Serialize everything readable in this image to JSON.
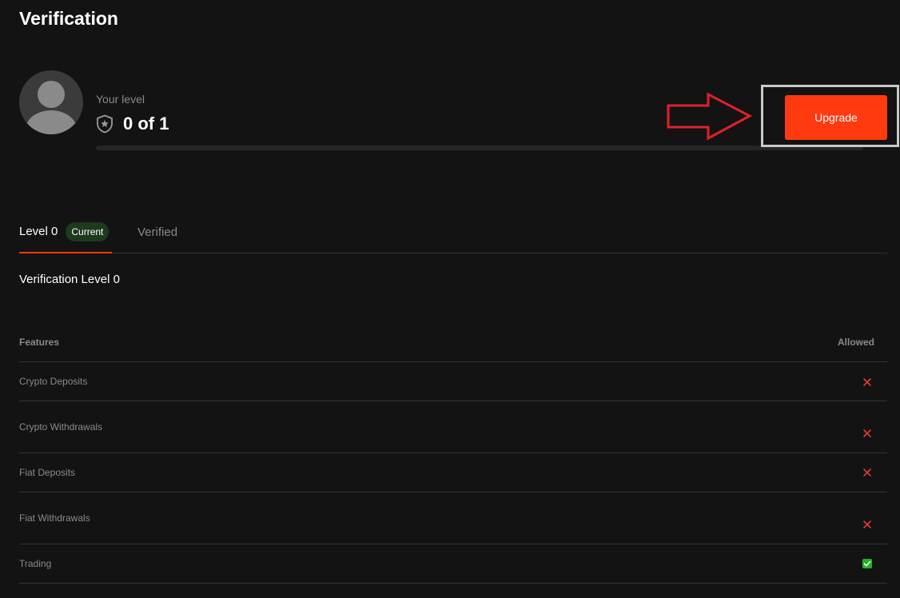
{
  "page": {
    "title": "Verification"
  },
  "level": {
    "label": "Your level",
    "value": "0 of 1",
    "progress_fraction": 0
  },
  "upgrade": {
    "label": "Upgrade"
  },
  "tabs": [
    {
      "label": "Level 0",
      "badge": "Current",
      "active": true
    },
    {
      "label": "Verified",
      "active": false
    }
  ],
  "section": {
    "title": "Verification Level 0"
  },
  "table": {
    "headers": {
      "features": "Features",
      "allowed": "Allowed"
    },
    "rows": [
      {
        "feature": "Crypto Deposits",
        "allowed": false,
        "icon": "cross-icon"
      },
      {
        "feature": "Crypto Withdrawals",
        "allowed": false,
        "icon": "cross-icon"
      },
      {
        "feature": "Fiat Deposits",
        "allowed": false,
        "icon": "cross-icon"
      },
      {
        "feature": "Fiat Withdrawals",
        "allowed": false,
        "icon": "cross-icon"
      },
      {
        "feature": "Trading",
        "allowed": true,
        "icon": "check-icon"
      }
    ]
  },
  "colors": {
    "background": "#131313",
    "accent": "#ff3a0f",
    "muted_text": "#8a8a8a",
    "badge_bg": "#1e3a1e",
    "deny": "#e53935",
    "allow": "#22b322",
    "annotation_arrow": "#e0202a",
    "annotation_frame": "#c8c8c8"
  }
}
